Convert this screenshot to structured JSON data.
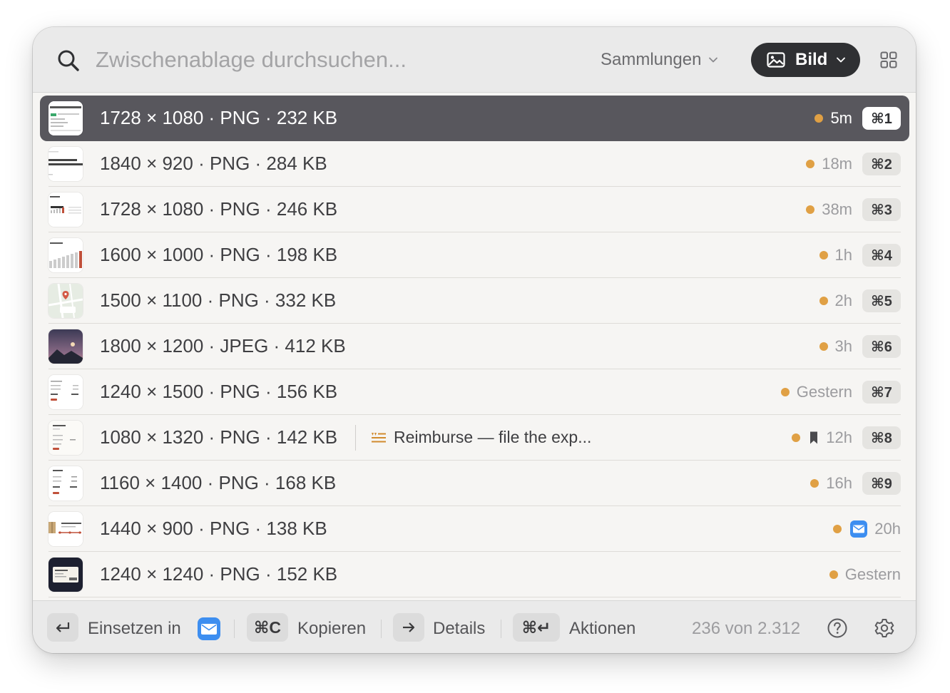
{
  "search": {
    "placeholder": "Zwischenablage durchsuchen..."
  },
  "header": {
    "collections_label": "Sammlungen",
    "filter_label": "Bild",
    "filter_icon": "image-icon"
  },
  "items": [
    {
      "title": "1728 × 1080 · PNG · 232 KB",
      "time": "5m",
      "shortcut": "⌘1",
      "selected": true,
      "thumb": "ui-screenshot"
    },
    {
      "title": "1840 × 920 · PNG · 284 KB",
      "time": "18m",
      "shortcut": "⌘2",
      "thumb": "text-doc"
    },
    {
      "title": "1728 × 1080 · PNG · 246 KB",
      "time": "38m",
      "shortcut": "⌘3",
      "thumb": "dashboard"
    },
    {
      "title": "1600 × 1000 · PNG · 198 KB",
      "time": "1h",
      "shortcut": "⌘4",
      "thumb": "bar-chart"
    },
    {
      "title": "1500 × 1100 · PNG · 332 KB",
      "time": "2h",
      "shortcut": "⌘5",
      "thumb": "map"
    },
    {
      "title": "1800 × 1200 · JPEG · 412 KB",
      "time": "3h",
      "shortcut": "⌘6",
      "thumb": "landscape-photo"
    },
    {
      "title": "1240 × 1500 · PNG · 156 KB",
      "time": "Gestern",
      "shortcut": "⌘7",
      "thumb": "receipt"
    },
    {
      "title": "1080 × 1320 · PNG · 142 KB",
      "time": "12h",
      "shortcut": "⌘8",
      "thumb": "form",
      "bookmark": true,
      "note": {
        "icon": "note-icon",
        "text": "Reimburse — file the exp..."
      }
    },
    {
      "title": "1160 × 1400 · PNG · 168 KB",
      "time": "16h",
      "shortcut": "⌘9",
      "thumb": "invoice"
    },
    {
      "title": "1440 × 900 · PNG · 138 KB",
      "time": "20h",
      "source_icon": "mail-app-icon",
      "thumb": "shipping"
    },
    {
      "title": "1240 × 1240 · PNG · 152 KB",
      "time": "Gestern",
      "thumb": "ticket-dark"
    }
  ],
  "colors": {
    "accent_dot": "#e0a044",
    "selected_row": "#58575d",
    "filter_bg": "#2f3033"
  },
  "footer": {
    "paste_key": "↵",
    "paste_label": "Einsetzen in",
    "paste_target_icon": "mail-app-icon",
    "copy_key": "⌘C",
    "copy_label": "Kopieren",
    "details_key": "→",
    "details_label": "Details",
    "actions_key": "⌘↵",
    "actions_label": "Aktionen",
    "count": "236 von 2.312"
  }
}
